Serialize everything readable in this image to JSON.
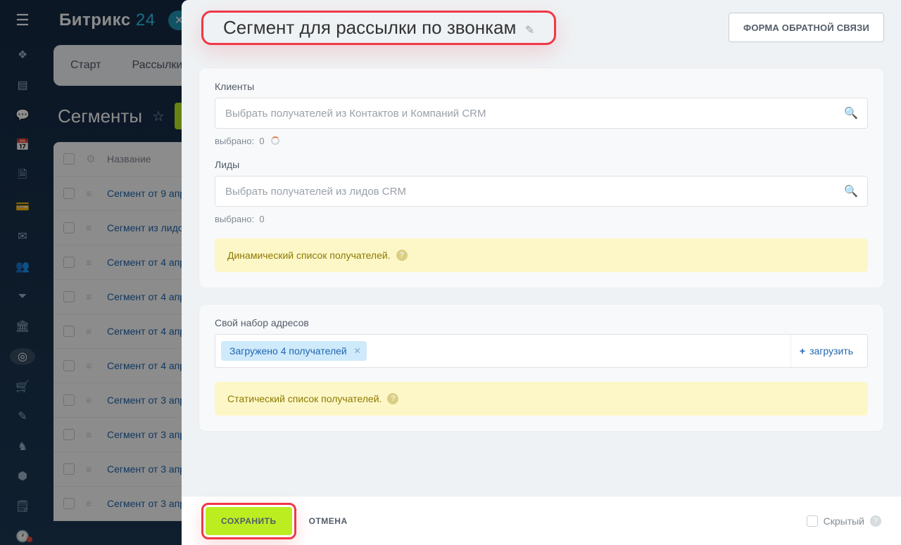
{
  "brand": {
    "name1": "Битрикс",
    "name2": "24"
  },
  "bg": {
    "tabs": [
      "Старт",
      "Рассылки"
    ],
    "pageTitle": "Сегменты",
    "table": {
      "headerName": "Название",
      "rows": [
        "Сегмент от 9 апр",
        "Сегмент из лидо",
        "Сегмент от 4 апр",
        "Сегмент от 4 апр",
        "Сегмент от 4 апр",
        "Сегмент от 4 апр",
        "Сегмент от 3 апр",
        "Сегмент от 3 апр",
        "Сегмент от 3 апр",
        "Сегмент от 3 апр"
      ]
    }
  },
  "panel": {
    "title": "Сегмент для рассылки по звонкам",
    "feedbackBtn": "ФОРМА ОБРАТНОЙ СВЯЗИ",
    "clients": {
      "label": "Клиенты",
      "placeholder": "Выбрать получателей из Контактов и Компаний CRM",
      "selectedLabel": "выбрано:",
      "selectedCount": "0"
    },
    "leads": {
      "label": "Лиды",
      "placeholder": "Выбрать получателей из лидов CRM",
      "selectedLabel": "выбрано:",
      "selectedCount": "0"
    },
    "dynamicInfo": "Динамический список получателей.",
    "own": {
      "label": "Свой набор адресов",
      "chip": "Загружено 4 получателей",
      "upload": "загрузить"
    },
    "staticInfo": "Статический список получателей.",
    "save": "СОХРАНИТЬ",
    "cancel": "ОТМЕНА",
    "hidden": "Скрытый"
  }
}
